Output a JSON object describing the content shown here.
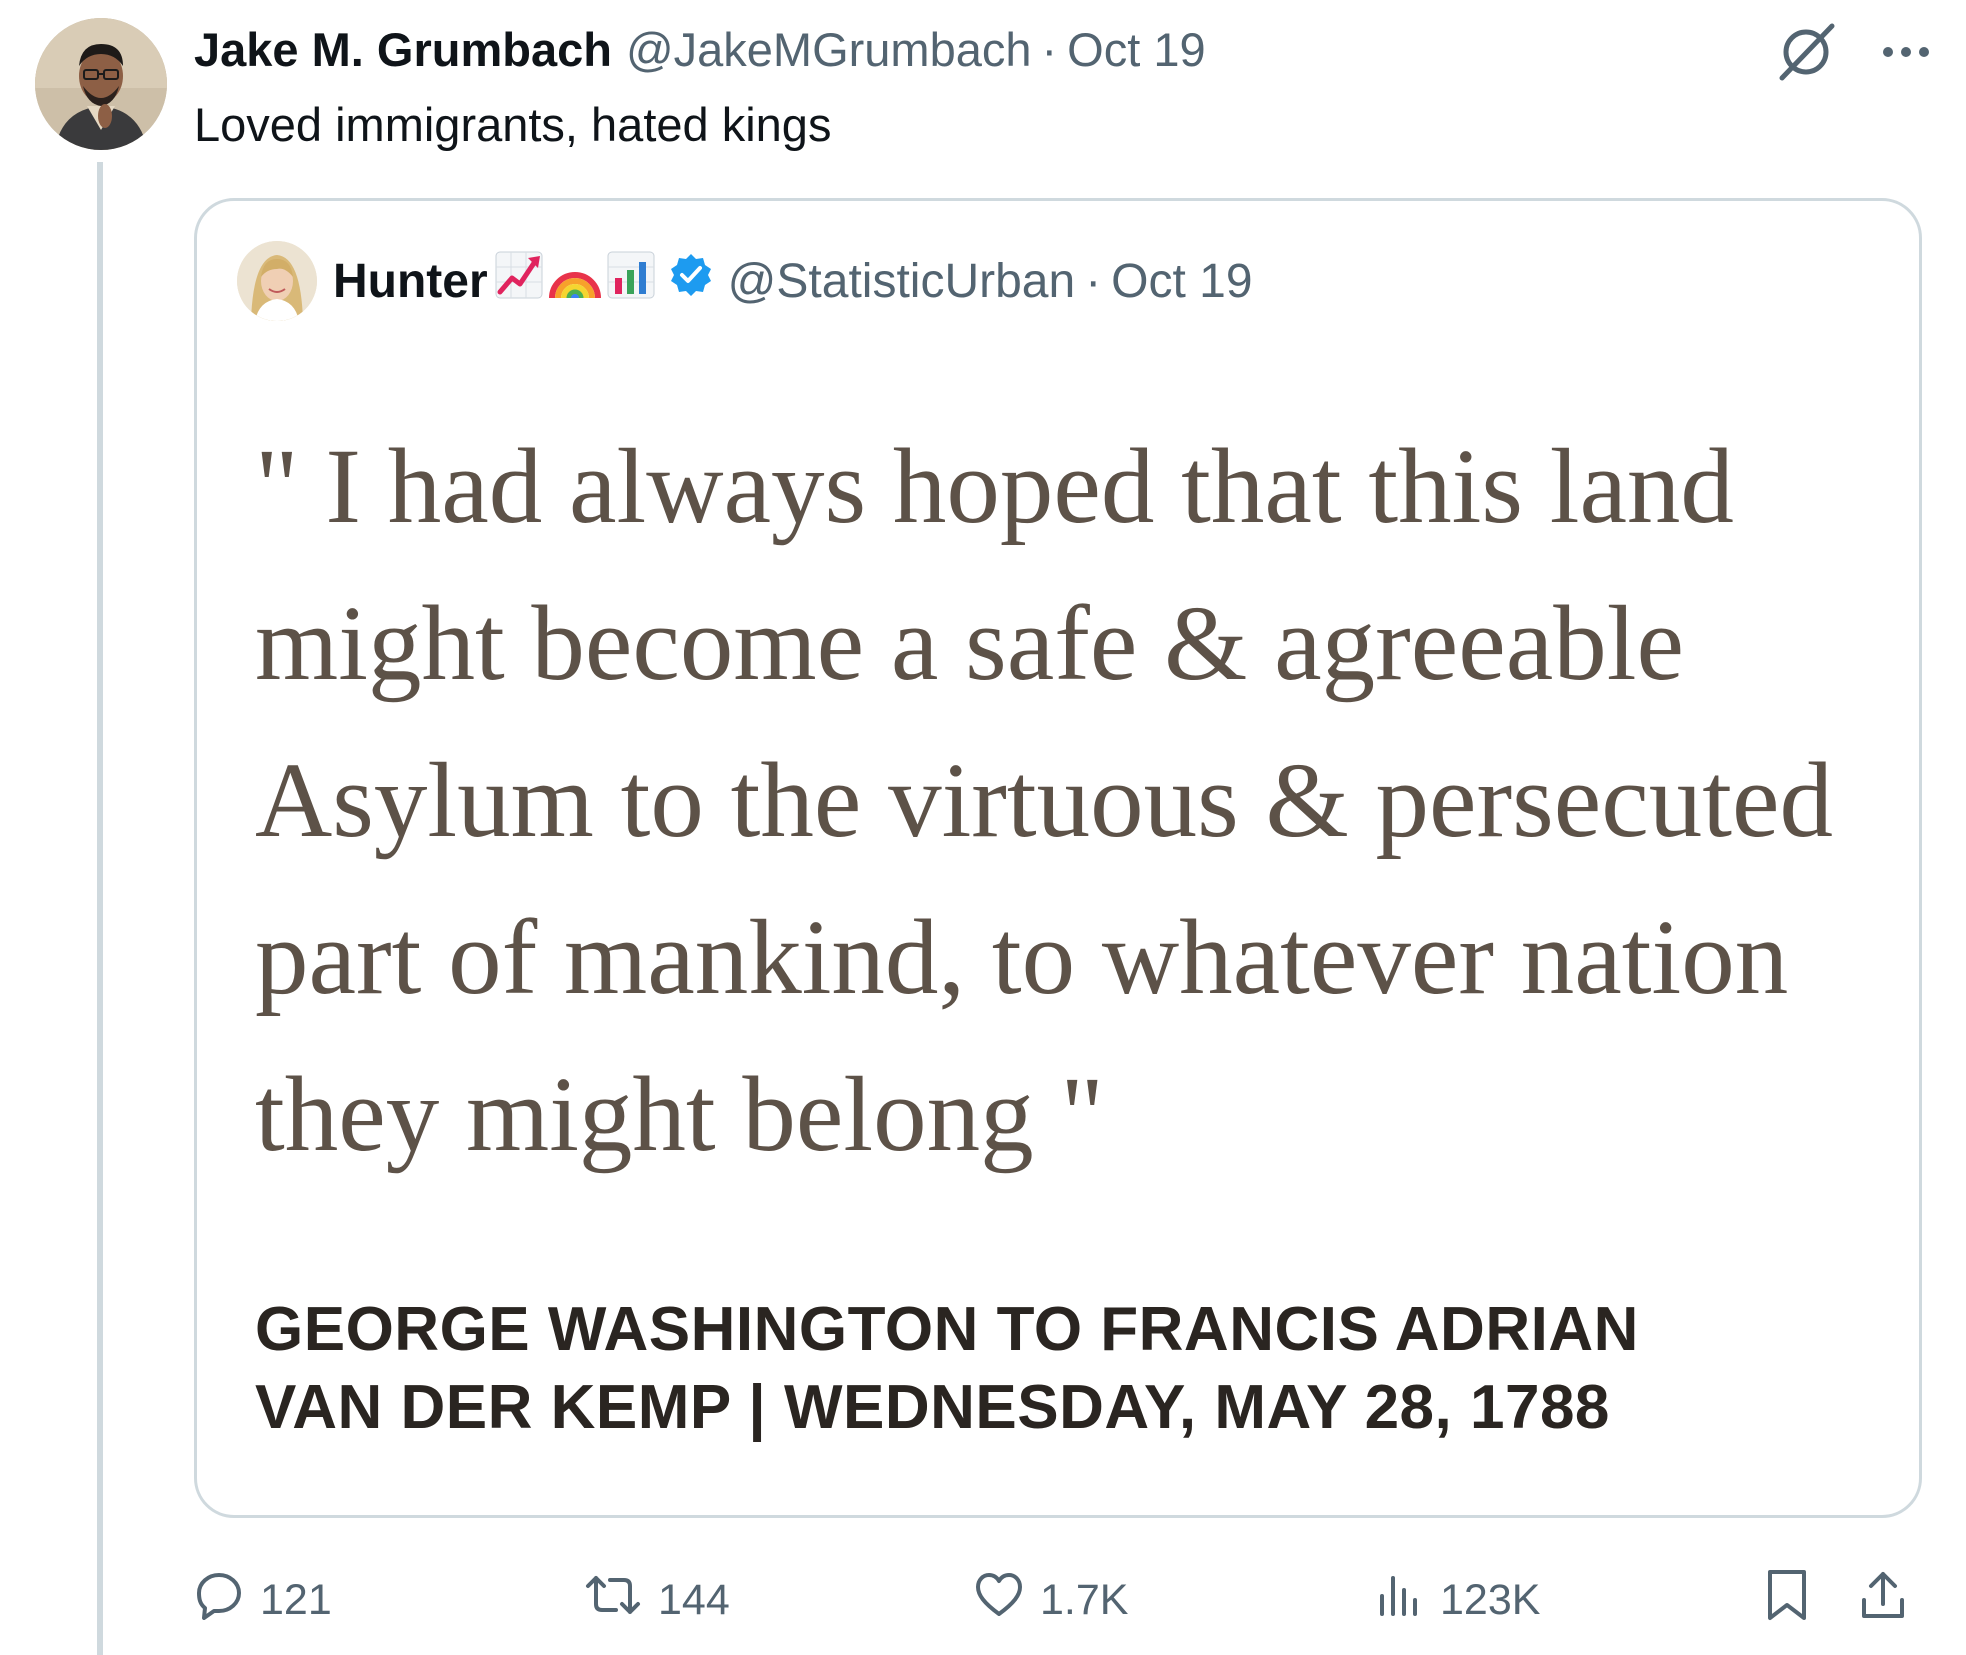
{
  "tweet": {
    "author_name": "Jake M. Grumbach",
    "author_handle": "@JakeMGrumbach",
    "separator": "·",
    "date": "Oct 19",
    "text": "Loved immigrants, hated kings"
  },
  "quoted_tweet": {
    "author_name": "Hunter",
    "author_emojis": [
      "chart-increasing-icon",
      "rainbow-icon",
      "bar-chart-icon"
    ],
    "verified": true,
    "author_handle": "@StatisticUrban",
    "separator": "·",
    "date": "Oct 19",
    "quote_lines": [
      "\" I had always hoped that this land",
      "might become a safe & agreeable",
      "Asylum to the virtuous & persecuted",
      "part of mankind, to whatever nation",
      "they might belong \""
    ],
    "attribution_lines": [
      "GEORGE WASHINGTON TO FRANCIS ADRIAN",
      "VAN DER KEMP | WEDNESDAY, MAY 28, 1788"
    ]
  },
  "actions": {
    "replies": "121",
    "reposts": "144",
    "likes": "1.7K",
    "views": "123K"
  },
  "colors": {
    "text": "#0f1419",
    "muted": "#536471",
    "border": "#cfd9de",
    "verified": "#1d9bf0",
    "quote_text": "#5d5248",
    "attribution_text": "#2a2521"
  },
  "icons": [
    "grok-icon",
    "more-icon",
    "reply-icon",
    "repost-icon",
    "like-icon",
    "views-icon",
    "bookmark-icon",
    "share-icon",
    "verified-icon"
  ]
}
